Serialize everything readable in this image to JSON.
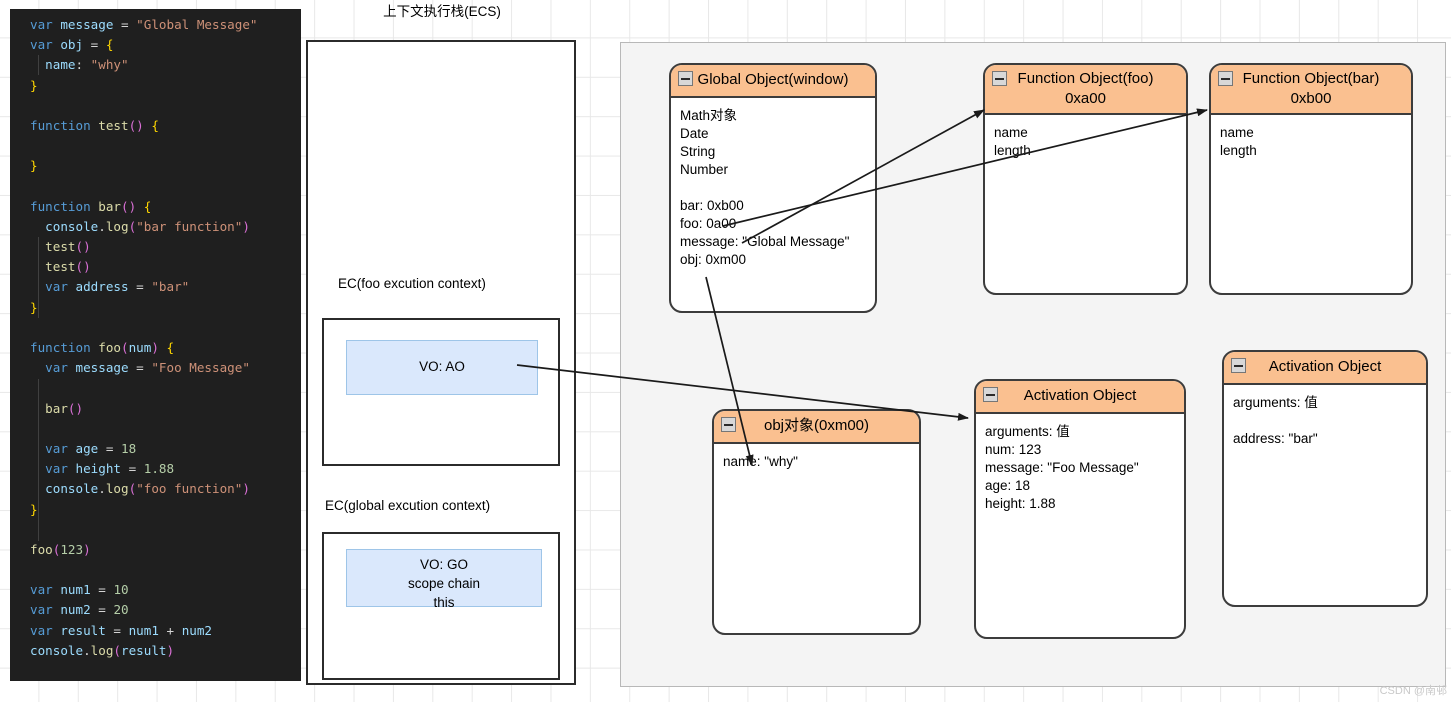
{
  "code": {
    "lines": [
      [
        {
          "t": "var ",
          "c": "kw"
        },
        {
          "t": "message",
          "c": "var"
        },
        {
          "t": " = ",
          "c": "op"
        },
        {
          "t": "\"Global Message\"",
          "c": "str"
        }
      ],
      [
        {
          "t": "var ",
          "c": "kw"
        },
        {
          "t": "obj",
          "c": "var"
        },
        {
          "t": " = ",
          "c": "op"
        },
        {
          "t": "{",
          "c": "br"
        }
      ],
      [
        {
          "t": "  name",
          "c": "obj"
        },
        {
          "t": ": ",
          "c": "op"
        },
        {
          "t": "\"why\"",
          "c": "str"
        }
      ],
      [
        {
          "t": "}",
          "c": "br"
        }
      ],
      [],
      [
        {
          "t": "function ",
          "c": "kw"
        },
        {
          "t": "test",
          "c": "fn"
        },
        {
          "t": "()",
          "c": "pa"
        },
        {
          "t": " ",
          "c": "op"
        },
        {
          "t": "{",
          "c": "br"
        }
      ],
      [],
      [
        {
          "t": "}",
          "c": "br"
        }
      ],
      [],
      [
        {
          "t": "function ",
          "c": "kw"
        },
        {
          "t": "bar",
          "c": "fn"
        },
        {
          "t": "()",
          "c": "pa"
        },
        {
          "t": " ",
          "c": "op"
        },
        {
          "t": "{",
          "c": "br"
        }
      ],
      [
        {
          "t": "  console",
          "c": "obj"
        },
        {
          "t": ".",
          "c": "op"
        },
        {
          "t": "log",
          "c": "prop"
        },
        {
          "t": "(",
          "c": "pa"
        },
        {
          "t": "\"bar function\"",
          "c": "str"
        },
        {
          "t": ")",
          "c": "pa"
        }
      ],
      [
        {
          "t": "  test",
          "c": "fn"
        },
        {
          "t": "()",
          "c": "pa"
        }
      ],
      [
        {
          "t": "  test",
          "c": "fn"
        },
        {
          "t": "()",
          "c": "pa"
        }
      ],
      [
        {
          "t": "  var ",
          "c": "kw"
        },
        {
          "t": "address",
          "c": "var"
        },
        {
          "t": " = ",
          "c": "op"
        },
        {
          "t": "\"bar\"",
          "c": "str"
        }
      ],
      [
        {
          "t": "}",
          "c": "br"
        }
      ],
      [],
      [
        {
          "t": "function ",
          "c": "kw"
        },
        {
          "t": "foo",
          "c": "fn"
        },
        {
          "t": "(",
          "c": "pa"
        },
        {
          "t": "num",
          "c": "var"
        },
        {
          "t": ")",
          "c": "pa"
        },
        {
          "t": " ",
          "c": "op"
        },
        {
          "t": "{",
          "c": "br"
        }
      ],
      [
        {
          "t": "  var ",
          "c": "kw"
        },
        {
          "t": "message",
          "c": "var"
        },
        {
          "t": " = ",
          "c": "op"
        },
        {
          "t": "\"Foo Message\"",
          "c": "str"
        }
      ],
      [],
      [
        {
          "t": "  bar",
          "c": "fn"
        },
        {
          "t": "()",
          "c": "pa"
        }
      ],
      [],
      [
        {
          "t": "  var ",
          "c": "kw"
        },
        {
          "t": "age",
          "c": "var"
        },
        {
          "t": " = ",
          "c": "op"
        },
        {
          "t": "18",
          "c": "num"
        }
      ],
      [
        {
          "t": "  var ",
          "c": "kw"
        },
        {
          "t": "height",
          "c": "var"
        },
        {
          "t": " = ",
          "c": "op"
        },
        {
          "t": "1.88",
          "c": "num"
        }
      ],
      [
        {
          "t": "  console",
          "c": "obj"
        },
        {
          "t": ".",
          "c": "op"
        },
        {
          "t": "log",
          "c": "prop"
        },
        {
          "t": "(",
          "c": "pa"
        },
        {
          "t": "\"foo function\"",
          "c": "str"
        },
        {
          "t": ")",
          "c": "pa"
        }
      ],
      [
        {
          "t": "}",
          "c": "br"
        }
      ],
      [],
      [
        {
          "t": "foo",
          "c": "fn"
        },
        {
          "t": "(",
          "c": "pa"
        },
        {
          "t": "123",
          "c": "num"
        },
        {
          "t": ")",
          "c": "pa"
        }
      ],
      [],
      [
        {
          "t": "var ",
          "c": "kw"
        },
        {
          "t": "num1",
          "c": "var"
        },
        {
          "t": " = ",
          "c": "op"
        },
        {
          "t": "10",
          "c": "num"
        }
      ],
      [
        {
          "t": "var ",
          "c": "kw"
        },
        {
          "t": "num2",
          "c": "var"
        },
        {
          "t": " = ",
          "c": "op"
        },
        {
          "t": "20",
          "c": "num"
        }
      ],
      [
        {
          "t": "var ",
          "c": "kw"
        },
        {
          "t": "result",
          "c": "var"
        },
        {
          "t": " = ",
          "c": "op"
        },
        {
          "t": "num1",
          "c": "var"
        },
        {
          "t": " + ",
          "c": "op"
        },
        {
          "t": "num2",
          "c": "var"
        }
      ],
      [
        {
          "t": "console",
          "c": "obj"
        },
        {
          "t": ".",
          "c": "op"
        },
        {
          "t": "log",
          "c": "prop"
        },
        {
          "t": "(",
          "c": "pa"
        },
        {
          "t": "result",
          "c": "var"
        },
        {
          "t": ")",
          "c": "pa"
        }
      ]
    ]
  },
  "ecs": {
    "title": "上下文执行栈(ECS)",
    "foo_label": "EC(foo excution context)",
    "foo_vo": "VO: AO",
    "global_label": "EC(global excution context)",
    "global_vo_lines": [
      "VO: GO",
      "scope chain",
      "this"
    ]
  },
  "heap": {
    "global_object": {
      "title": "Global Object(window)",
      "rows": [
        "Math对象",
        "Date",
        "String",
        "Number",
        "",
        "bar: 0xb00",
        "foo: 0a00",
        "message: \"Global Message\"",
        "obj: 0xm00"
      ]
    },
    "function_foo": {
      "title_line1": "Function Object(foo)",
      "title_line2": "0xa00",
      "rows": [
        "name",
        "length"
      ]
    },
    "function_bar": {
      "title_line1": "Function Object(bar)",
      "title_line2": "0xb00",
      "rows": [
        "name",
        "length"
      ]
    },
    "obj_object": {
      "title": "obj对象(0xm00)",
      "rows": [
        "name: \"why\""
      ]
    },
    "activation_foo": {
      "title": "Activation Object",
      "rows": [
        "arguments: 值",
        "num: 123",
        "message: \"Foo Message\"",
        "age: 18",
        "height: 1.88"
      ]
    },
    "activation_bar": {
      "title": "Activation Object",
      "rows": [
        "arguments: 值",
        "",
        "address: \"bar\""
      ]
    }
  },
  "watermark": "CSDN @南邨",
  "colors": {
    "uml_header": "#fac090",
    "uml_border": "#3c3c3c",
    "vo_fill": "#dae8fc",
    "vo_border": "#9ec5e8",
    "heap_bg": "#f4f4f4",
    "editor_bg": "#1f1f1f"
  }
}
